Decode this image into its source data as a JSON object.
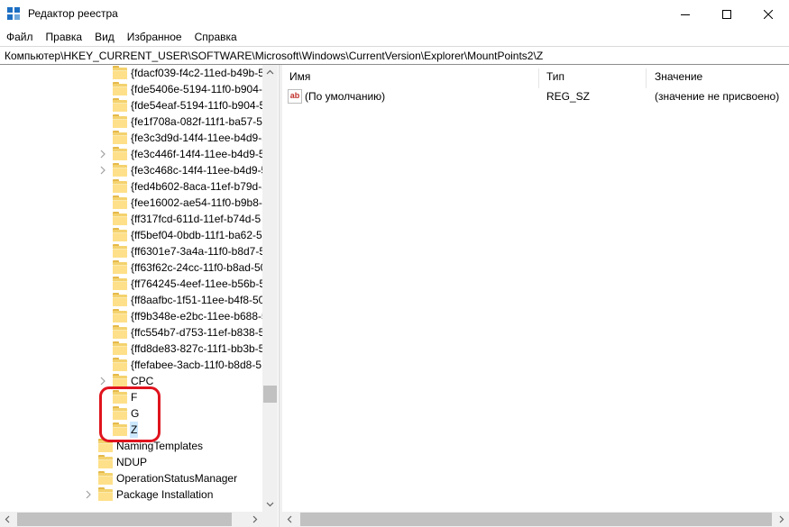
{
  "window": {
    "title": "Редактор реестра"
  },
  "menu": [
    "Файл",
    "Правка",
    "Вид",
    "Избранное",
    "Справка"
  ],
  "address": "Компьютер\\HKEY_CURRENT_USER\\SOFTWARE\\Microsoft\\Windows\\CurrentVersion\\Explorer\\MountPoints2\\Z",
  "tree": {
    "items": [
      {
        "label": "{fdacf039-f4c2-11ed-b49b-5",
        "expandable": false
      },
      {
        "label": "{fde5406e-5194-11f0-b904-5",
        "expandable": false
      },
      {
        "label": "{fde54eaf-5194-11f0-b904-5",
        "expandable": false
      },
      {
        "label": "{fe1f708a-082f-11f1-ba57-50",
        "expandable": false
      },
      {
        "label": "{fe3c3d9d-14f4-11ee-b4d9-5",
        "expandable": false
      },
      {
        "label": "{fe3c446f-14f4-11ee-b4d9-5",
        "expandable": true
      },
      {
        "label": "{fe3c468c-14f4-11ee-b4d9-5",
        "expandable": true
      },
      {
        "label": "{fed4b602-8aca-11ef-b79d-5",
        "expandable": false
      },
      {
        "label": "{fee16002-ae54-11f0-b9b8-5",
        "expandable": false
      },
      {
        "label": "{ff317fcd-611d-11ef-b74d-5",
        "expandable": false
      },
      {
        "label": "{ff5bef04-0bdb-11f1-ba62-5",
        "expandable": false
      },
      {
        "label": "{ff6301e7-3a4a-11f0-b8d7-5",
        "expandable": false
      },
      {
        "label": "{ff63f62c-24cc-11f0-b8ad-50",
        "expandable": false
      },
      {
        "label": "{ff764245-4eef-11ee-b56b-5",
        "expandable": false
      },
      {
        "label": "{ff8aafbc-1f51-11ee-b4f8-50",
        "expandable": false
      },
      {
        "label": "{ff9b348e-e2bc-11ee-b688-5",
        "expandable": false
      },
      {
        "label": "{ffc554b7-d753-11ef-b838-5",
        "expandable": false
      },
      {
        "label": "{ffd8de83-827c-11f1-bb3b-5",
        "expandable": false
      },
      {
        "label": "{ffefabee-3acb-11f0-b8d8-5",
        "expandable": false
      },
      {
        "label": "CPC",
        "expandable": true
      },
      {
        "label": "F",
        "expandable": false
      },
      {
        "label": "G",
        "expandable": false
      },
      {
        "label": "Z",
        "expandable": false,
        "selected": true
      },
      {
        "label": "NamingTemplates",
        "expandable": false
      },
      {
        "label": "NDUP",
        "expandable": false
      },
      {
        "label": "OperationStatusManager",
        "expandable": false
      },
      {
        "label": "Package Installation",
        "expandable": true
      }
    ]
  },
  "values": {
    "headers": {
      "name": "Имя",
      "type": "Тип",
      "data": "Значение"
    },
    "rows": [
      {
        "name": "(По умолчанию)",
        "type": "REG_SZ",
        "data": "(значение не присвоено)",
        "icon": "string-value-icon"
      }
    ],
    "icon_glyph": "ab"
  },
  "colors": {
    "selection": "#cce8ff",
    "highlight_ring": "#e0141e",
    "folder": "#ffe08a"
  }
}
